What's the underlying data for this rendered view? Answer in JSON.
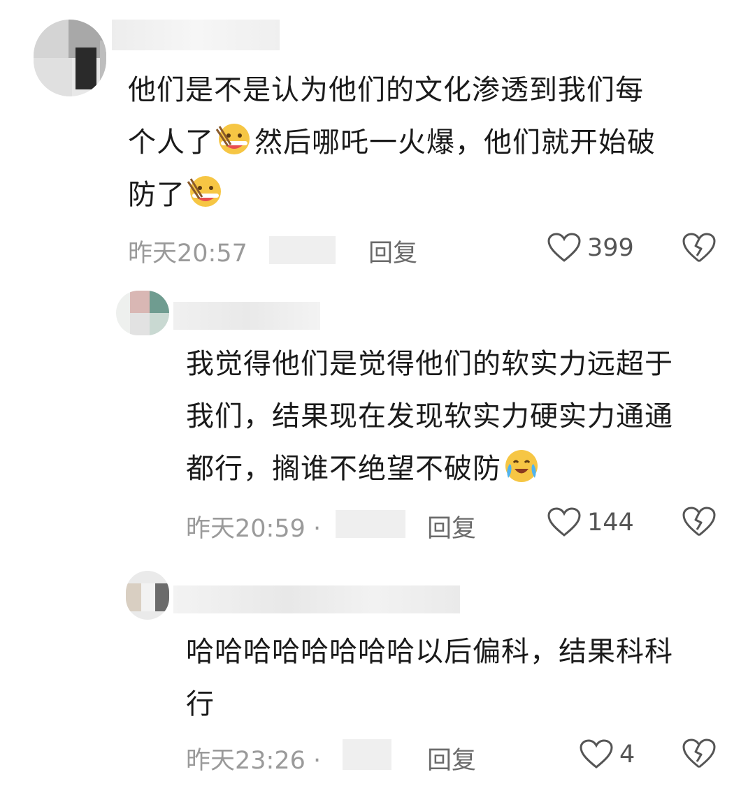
{
  "comments": [
    {
      "lines": [
        "他们是不是认为他们的文化渗透到我们每",
        "个人了",
        "然后哪吒一火爆，他们就开始破",
        "防了"
      ],
      "time": "昨天20:57",
      "reply": "回复",
      "likes": "399"
    },
    {
      "lines": [
        "我觉得他们是觉得他们的软实力远超于",
        "我们，结果现在发现软实力硬实力通通",
        "都行，搁谁不绝望不破防"
      ],
      "time": "昨天20:59 ·",
      "reply": "回复",
      "likes": "144"
    },
    {
      "lines": [
        "哈哈哈哈哈哈哈哈以后偏科，结果科科",
        "行"
      ],
      "time": "昨天23:26 ·",
      "reply": "回复",
      "likes": "4"
    }
  ],
  "icons": {
    "like": "heart-outline-icon",
    "dislike": "broken-heart-icon",
    "emoji_1": "eating-noodles-emoji",
    "emoji_2": "crying-laughing-emoji"
  }
}
